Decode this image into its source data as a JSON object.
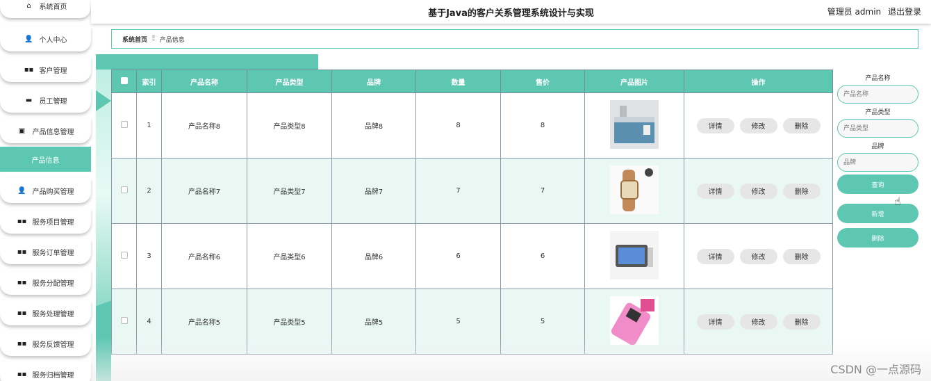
{
  "header": {
    "title": "基于Java的客户关系管理系统设计与实现",
    "user": "管理员 admin",
    "logout": "退出登录"
  },
  "sidebar": {
    "items": [
      {
        "label": "系统首页",
        "icon": "home-icon",
        "glyph": "⌂"
      },
      {
        "label": "个人中心",
        "icon": "user-icon",
        "glyph": "👤"
      },
      {
        "label": "客户管理",
        "icon": "grid-icon",
        "glyph": "▪▪"
      },
      {
        "label": "员工管理",
        "icon": "id-card-icon",
        "glyph": "▬"
      },
      {
        "label": "产品信息管理",
        "icon": "clipboard-icon",
        "glyph": "▣"
      },
      {
        "label": "产品信息",
        "icon": "",
        "glyph": ""
      },
      {
        "label": "产品购买管理",
        "icon": "user-icon",
        "glyph": "👤"
      },
      {
        "label": "服务项目管理",
        "icon": "grid-icon",
        "glyph": "▪▪"
      },
      {
        "label": "服务订单管理",
        "icon": "grid-icon",
        "glyph": "▪▪"
      },
      {
        "label": "服务分配管理",
        "icon": "grid-icon",
        "glyph": "▪▪"
      },
      {
        "label": "服务处理管理",
        "icon": "grid-icon",
        "glyph": "▪▪"
      },
      {
        "label": "服务反馈管理",
        "icon": "grid-icon",
        "glyph": "▪▪"
      },
      {
        "label": "服务归档管理",
        "icon": "grid-icon",
        "glyph": "▪▪"
      }
    ],
    "active_index": 5
  },
  "breadcrumb": {
    "home": "系统首页",
    "separator": "Ξ",
    "current": "产品信息"
  },
  "table": {
    "headers": [
      "",
      "索引",
      "产品名称",
      "产品类型",
      "品牌",
      "数量",
      "售价",
      "产品图片",
      "操作"
    ],
    "rows": [
      {
        "index": "1",
        "name": "产品名称8",
        "type": "产品类型8",
        "brand": "品牌8",
        "qty": "8",
        "price": "8",
        "image": "water-bath-photo"
      },
      {
        "index": "2",
        "name": "产品名称7",
        "type": "产品类型7",
        "brand": "品牌7",
        "qty": "7",
        "price": "7",
        "image": "wristwatch-photo"
      },
      {
        "index": "3",
        "name": "产品名称6",
        "type": "产品类型6",
        "brand": "品牌6",
        "qty": "6",
        "price": "6",
        "image": "tablet-photo"
      },
      {
        "index": "4",
        "name": "产品名称5",
        "type": "产品类型5",
        "brand": "品牌5",
        "qty": "5",
        "price": "5",
        "image": "pink-phone-photo"
      }
    ],
    "actions": {
      "detail": "详情",
      "edit": "修改",
      "delete": "删除"
    }
  },
  "filter": {
    "name_label": "产品名称",
    "name_placeholder": "产品名称",
    "type_label": "产品类型",
    "type_placeholder": "产品类型",
    "brand_label": "品牌",
    "brand_placeholder": "品牌",
    "search": "查询",
    "add": "新增",
    "delete": "删除"
  },
  "watermark": "CSDN @一点源码",
  "colors": {
    "accent": "#5ec7b2",
    "row_alt": "#eaf8f4"
  }
}
